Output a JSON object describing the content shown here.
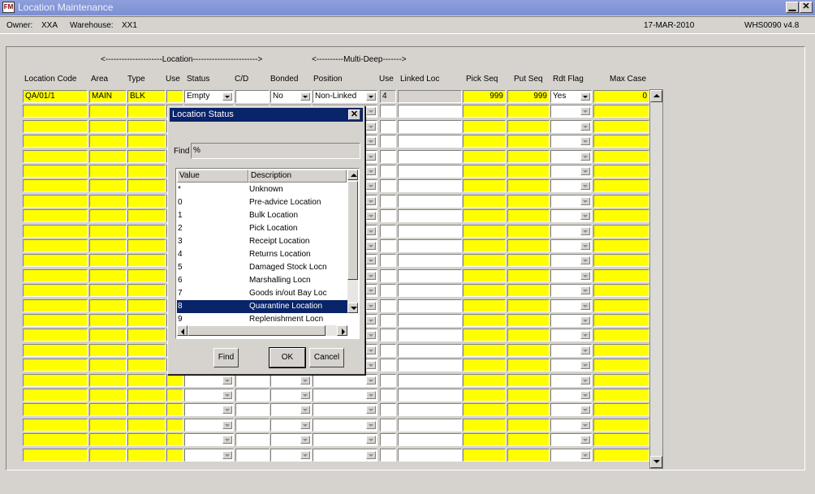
{
  "window": {
    "title": "Location Maintenance",
    "icon_text": "FM",
    "minimize_glyph": "▁",
    "close_glyph": "✕"
  },
  "info": {
    "owner_label": "Owner:",
    "owner_value": "XXA",
    "warehouse_label": "Warehouse:",
    "warehouse_value": "XX1",
    "date": "17-MAR-2010",
    "app_version": "WHS0090  v4.8"
  },
  "group_labels": {
    "location": "<---------------------Location------------------------>",
    "multi_deep": "<----------Multi-Deep------->"
  },
  "columns": {
    "location_code": "Location Code",
    "area": "Area",
    "type": "Type",
    "use": "Use",
    "status": "Status",
    "cd": "C/D",
    "bonded": "Bonded",
    "position": "Position",
    "md_use": "Use",
    "linked_loc": "Linked Loc",
    "pick_seq": "Pick Seq",
    "put_seq": "Put Seq",
    "rdt_flag": "Rdt Flag",
    "max_case": "Max Case"
  },
  "first_row": {
    "location_code": "QA/01/1",
    "area": "MAIN",
    "type": "BLK",
    "use": "",
    "status": "Empty",
    "cd": "",
    "bonded": "No",
    "position": "Non-Linked",
    "md_use": "4",
    "linked_loc": "",
    "pick_seq": "999",
    "put_seq": "999",
    "rdt_flag": "Yes",
    "max_case": "0"
  },
  "dialog": {
    "title": "Location Status",
    "close_glyph": "✕",
    "find_label": "Find",
    "find_value": "%",
    "col_value": "Value",
    "col_description": "Description",
    "items": [
      {
        "value": "*",
        "description": "Unknown"
      },
      {
        "value": "0",
        "description": "Pre-advice Location"
      },
      {
        "value": "1",
        "description": "Bulk Location"
      },
      {
        "value": "2",
        "description": "Pick Location"
      },
      {
        "value": "3",
        "description": "Receipt Location"
      },
      {
        "value": "4",
        "description": "Returns Location"
      },
      {
        "value": "5",
        "description": "Damaged Stock Locn"
      },
      {
        "value": "6",
        "description": "Marshalling Locn"
      },
      {
        "value": "7",
        "description": "Goods in/out Bay Loc"
      },
      {
        "value": "8",
        "description": "Quarantine Location"
      },
      {
        "value": "9",
        "description": "Replenishment Locn"
      }
    ],
    "selected_index": 9,
    "find_button": "Find",
    "ok_button": "OK",
    "cancel_button": "Cancel"
  },
  "colors": {
    "mandatory_field": "#ffff00",
    "selection": "#0a246a",
    "window_background": "#d6d3ce"
  }
}
